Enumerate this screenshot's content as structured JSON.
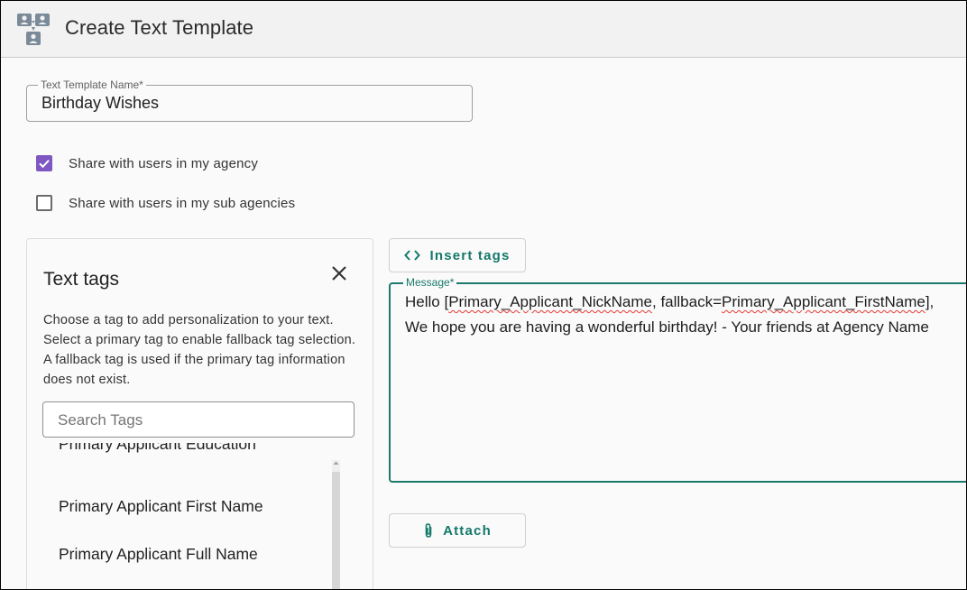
{
  "header": {
    "title": "Create Text Template",
    "icon": "contacts-group-icon"
  },
  "form": {
    "name_label": "Text Template Name*",
    "name_value": "Birthday Wishes"
  },
  "sharing": {
    "agency_label": "Share with users in my agency",
    "agency_checked": true,
    "sub_agencies_label": "Share with users in my sub agencies",
    "sub_agencies_checked": false,
    "checkbox_color": "#7e57c2"
  },
  "tags_panel": {
    "title": "Text tags",
    "description": "Choose a tag to add personalization to your text. Select a primary tag to enable fallback tag selection. A fallback tag is used if the primary tag information does not exist.",
    "search_placeholder": "Search Tags",
    "items": [
      "Primary Applicant Education",
      "Primary Applicant First Name",
      "Primary Applicant Full Name"
    ]
  },
  "actions": {
    "insert_tags_label": "Insert tags",
    "attach_label": "Attach",
    "accent_color": "#14786a"
  },
  "message": {
    "label": "Message*",
    "line1_prefix": "Hello [",
    "line1_tag": "Primary_Applicant_NickName",
    "line1_middle": ", fallback=",
    "line1_fallback": "Primary_Applicant_FirstName",
    "line1_suffix": "],",
    "line2": "We hope you are having a wonderful birthday! - Your friends at Agency Name"
  }
}
